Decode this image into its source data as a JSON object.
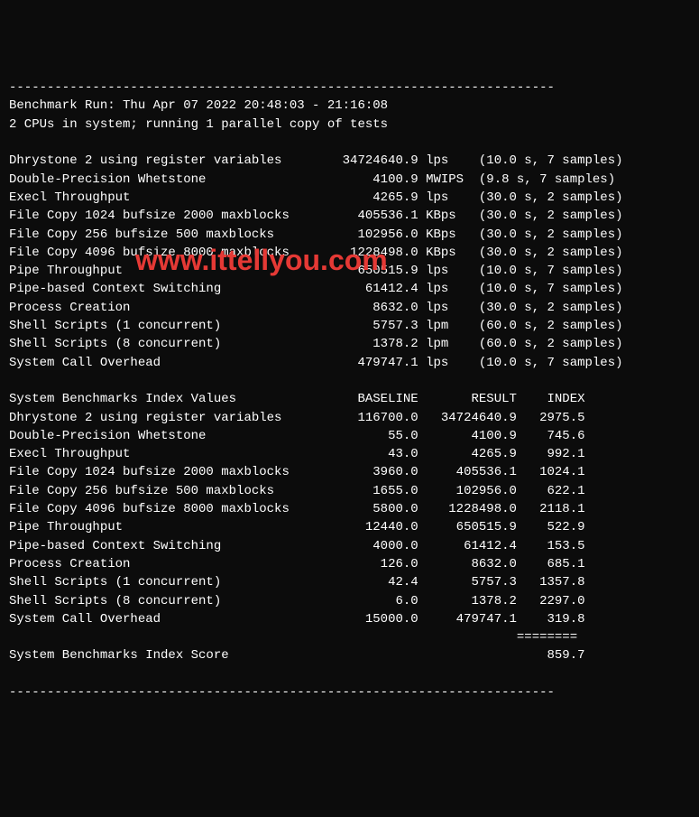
{
  "hr_top": "------------------------------------------------------------------------",
  "run_line": "Benchmark Run: Thu Apr 07 2022 20:48:03 - 21:16:08",
  "cpu_line": "2 CPUs in system; running 1 parallel copy of tests",
  "blank": "",
  "results": [
    {
      "name": "Dhrystone 2 using register variables",
      "value": "34724640.9",
      "unit": "lps",
      "time": "10.0 s",
      "samples": "7 samples"
    },
    {
      "name": "Double-Precision Whetstone",
      "value": "4100.9",
      "unit": "MWIPS",
      "time": "9.8 s",
      "samples": "7 samples"
    },
    {
      "name": "Execl Throughput",
      "value": "4265.9",
      "unit": "lps",
      "time": "30.0 s",
      "samples": "2 samples"
    },
    {
      "name": "File Copy 1024 bufsize 2000 maxblocks",
      "value": "405536.1",
      "unit": "KBps",
      "time": "30.0 s",
      "samples": "2 samples"
    },
    {
      "name": "File Copy 256 bufsize 500 maxblocks",
      "value": "102956.0",
      "unit": "KBps",
      "time": "30.0 s",
      "samples": "2 samples"
    },
    {
      "name": "File Copy 4096 bufsize 8000 maxblocks",
      "value": "1228498.0",
      "unit": "KBps",
      "time": "30.0 s",
      "samples": "2 samples"
    },
    {
      "name": "Pipe Throughput",
      "value": "650515.9",
      "unit": "lps",
      "time": "10.0 s",
      "samples": "7 samples"
    },
    {
      "name": "Pipe-based Context Switching",
      "value": "61412.4",
      "unit": "lps",
      "time": "10.0 s",
      "samples": "7 samples"
    },
    {
      "name": "Process Creation",
      "value": "8632.0",
      "unit": "lps",
      "time": "30.0 s",
      "samples": "2 samples"
    },
    {
      "name": "Shell Scripts (1 concurrent)",
      "value": "5757.3",
      "unit": "lpm",
      "time": "60.0 s",
      "samples": "2 samples"
    },
    {
      "name": "Shell Scripts (8 concurrent)",
      "value": "1378.2",
      "unit": "lpm",
      "time": "60.0 s",
      "samples": "2 samples"
    },
    {
      "name": "System Call Overhead",
      "value": "479747.1",
      "unit": "lps",
      "time": "10.0 s",
      "samples": "7 samples"
    }
  ],
  "index_header": {
    "title": "System Benchmarks Index Values",
    "baseline": "BASELINE",
    "result": "RESULT",
    "index": "INDEX"
  },
  "index_rows": [
    {
      "name": "Dhrystone 2 using register variables",
      "baseline": "116700.0",
      "result": "34724640.9",
      "index": "2975.5"
    },
    {
      "name": "Double-Precision Whetstone",
      "baseline": "55.0",
      "result": "4100.9",
      "index": "745.6"
    },
    {
      "name": "Execl Throughput",
      "baseline": "43.0",
      "result": "4265.9",
      "index": "992.1"
    },
    {
      "name": "File Copy 1024 bufsize 2000 maxblocks",
      "baseline": "3960.0",
      "result": "405536.1",
      "index": "1024.1"
    },
    {
      "name": "File Copy 256 bufsize 500 maxblocks",
      "baseline": "1655.0",
      "result": "102956.0",
      "index": "622.1"
    },
    {
      "name": "File Copy 4096 bufsize 8000 maxblocks",
      "baseline": "5800.0",
      "result": "1228498.0",
      "index": "2118.1"
    },
    {
      "name": "Pipe Throughput",
      "baseline": "12440.0",
      "result": "650515.9",
      "index": "522.9"
    },
    {
      "name": "Pipe-based Context Switching",
      "baseline": "4000.0",
      "result": "61412.4",
      "index": "153.5"
    },
    {
      "name": "Process Creation",
      "baseline": "126.0",
      "result": "8632.0",
      "index": "685.1"
    },
    {
      "name": "Shell Scripts (1 concurrent)",
      "baseline": "42.4",
      "result": "5757.3",
      "index": "1357.8"
    },
    {
      "name": "Shell Scripts (8 concurrent)",
      "baseline": "6.0",
      "result": "1378.2",
      "index": "2297.0"
    },
    {
      "name": "System Call Overhead",
      "baseline": "15000.0",
      "result": "479747.1",
      "index": "319.8"
    }
  ],
  "equals": "                                                                   ========",
  "score_label": "System Benchmarks Index Score",
  "score_value": "859.7",
  "hr_bottom": "------------------------------------------------------------------------",
  "watermark": "www.ittellyou.com"
}
